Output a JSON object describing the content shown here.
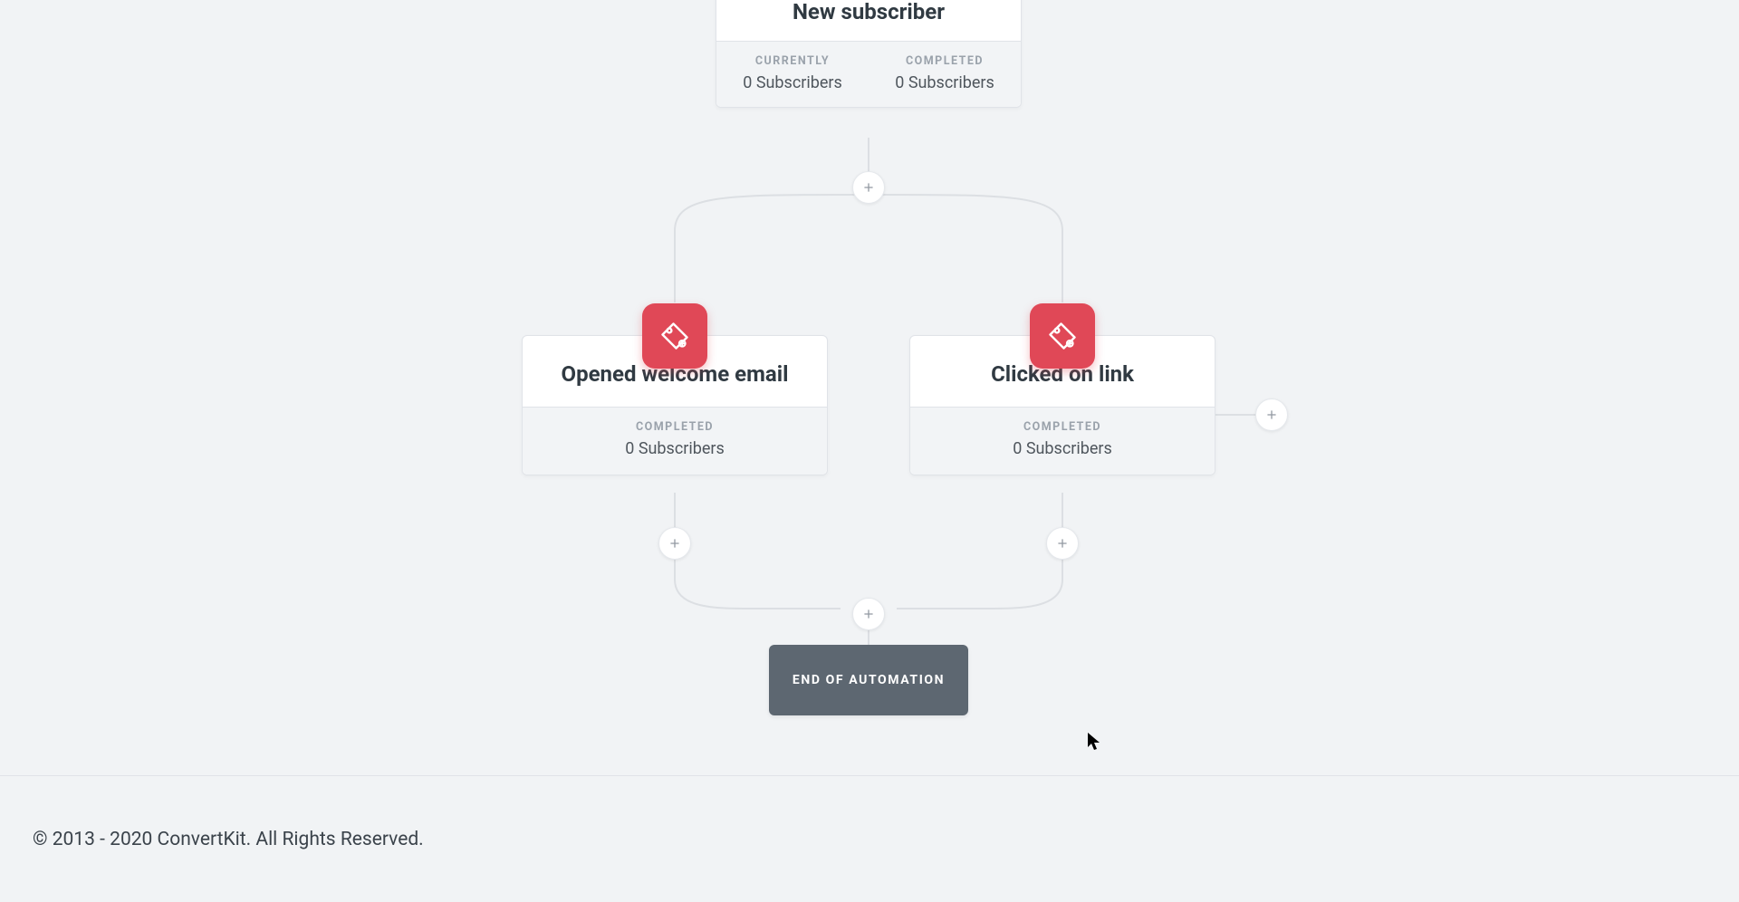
{
  "entry": {
    "title": "New subscriber",
    "currently_label": "CURRENTLY",
    "currently_value": "0 Subscribers",
    "completed_label": "COMPLETED",
    "completed_value": "0 Subscribers"
  },
  "branches": [
    {
      "title": "Opened welcome email",
      "completed_label": "COMPLETED",
      "completed_value": "0 Subscribers"
    },
    {
      "title": "Clicked on link",
      "completed_label": "COMPLETED",
      "completed_value": "0 Subscribers"
    }
  ],
  "end_label": "END OF AUTOMATION",
  "footer": "© 2013 - 2020 ConvertKit. All Rights Reserved."
}
